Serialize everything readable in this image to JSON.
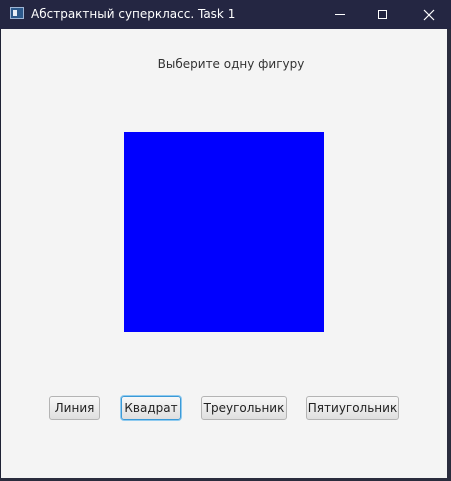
{
  "window": {
    "title": "Абстрактный суперкласс. Task 1",
    "controls": {
      "minimize_icon": "minimize-icon",
      "maximize_icon": "maximize-icon",
      "close_glyph": "✕"
    }
  },
  "main": {
    "prompt": "Выберите одну фигуру",
    "selected_shape": "Квадрат",
    "shape_color": "#0000ff"
  },
  "buttons": {
    "line": "Линия",
    "square": "Квадрат",
    "triangle": "Треугольник",
    "pentagon": "Пятиугольник"
  },
  "colors": {
    "titlebar": "#242642",
    "content_bg": "#f4f4f4",
    "focus_border": "#3b99d6"
  }
}
